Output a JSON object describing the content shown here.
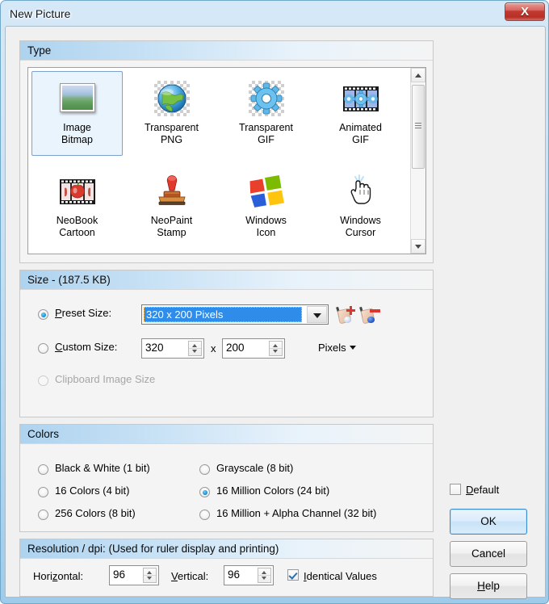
{
  "window": {
    "title": "New Picture",
    "close_icon": "close-icon",
    "close_label": "X"
  },
  "type_group": {
    "header": "Type",
    "selected_index": 0,
    "items": [
      {
        "label_line1": "Image",
        "label_line2": "Bitmap",
        "icon": "photo-icon"
      },
      {
        "label_line1": "Transparent",
        "label_line2": "PNG",
        "icon": "globe-icon"
      },
      {
        "label_line1": "Transparent",
        "label_line2": "GIF",
        "icon": "gear-icon"
      },
      {
        "label_line1": "Animated",
        "label_line2": "GIF",
        "icon": "filmstrip-gear-icon"
      },
      {
        "label_line1": "NeoBook",
        "label_line2": "Cartoon",
        "icon": "filmstrip-apple-icon"
      },
      {
        "label_line1": "NeoPaint",
        "label_line2": "Stamp",
        "icon": "rubber-stamp-icon"
      },
      {
        "label_line1": "Windows",
        "label_line2": "Icon",
        "icon": "windows-logo-icon"
      },
      {
        "label_line1": "Windows",
        "label_line2": "Cursor",
        "icon": "hand-cursor-icon"
      }
    ],
    "scrollbar": {
      "up_icon": "scroll-up-icon",
      "down_icon": "scroll-down-icon"
    }
  },
  "size_group": {
    "header": "Size - (187.5 KB)",
    "preset": {
      "label_prefix": "P",
      "label_rest": "reset Size:",
      "selected": true,
      "value": "320 x 200 Pixels",
      "dropdown_icon": "chevron-down-icon",
      "add_icon": "add-preset-icon",
      "remove_icon": "remove-preset-icon"
    },
    "custom": {
      "label_prefix": "C",
      "label_rest": "ustom Size:",
      "selected": false,
      "width_value": "320",
      "separator": "x",
      "height_value": "200",
      "units": "Pixels",
      "units_caret_icon": "chevron-down-icon"
    },
    "clipboard": {
      "label": "Clipboard Image Size",
      "disabled": true,
      "selected": false
    }
  },
  "colors_group": {
    "header": "Colors",
    "options": [
      {
        "label": "Black & White (1 bit)",
        "selected": false
      },
      {
        "label": "16 Colors (4 bit)",
        "selected": false
      },
      {
        "label": "256 Colors (8 bit)",
        "selected": false
      },
      {
        "label": "Grayscale (8 bit)",
        "selected": false
      },
      {
        "label": "16 Million Colors (24 bit)",
        "selected": true
      },
      {
        "label": "16 Million + Alpha Channel (32 bit)",
        "selected": false
      }
    ]
  },
  "resolution_group": {
    "header": "Resolution / dpi: (Used for ruler display and printing)",
    "horizontal_label_a": "Hori",
    "horizontal_label_acc": "z",
    "horizontal_label_b": "ontal:",
    "horizontal_value": "96",
    "vertical_label_acc": "V",
    "vertical_label_rest": "ertical:",
    "vertical_value": "96",
    "identical_acc": "I",
    "identical_rest": "dentical Values",
    "identical_checked": true
  },
  "actions": {
    "default_acc": "D",
    "default_rest": "efault",
    "default_checked": false,
    "ok": "OK",
    "cancel": "Cancel",
    "help_acc": "H",
    "help_rest": "elp"
  },
  "colors": {
    "accent_blue": "#2f8ce8",
    "frame_blue": "#9fcbea",
    "close_red": "#c23a30",
    "group_header_blue": "#aed3ef"
  }
}
